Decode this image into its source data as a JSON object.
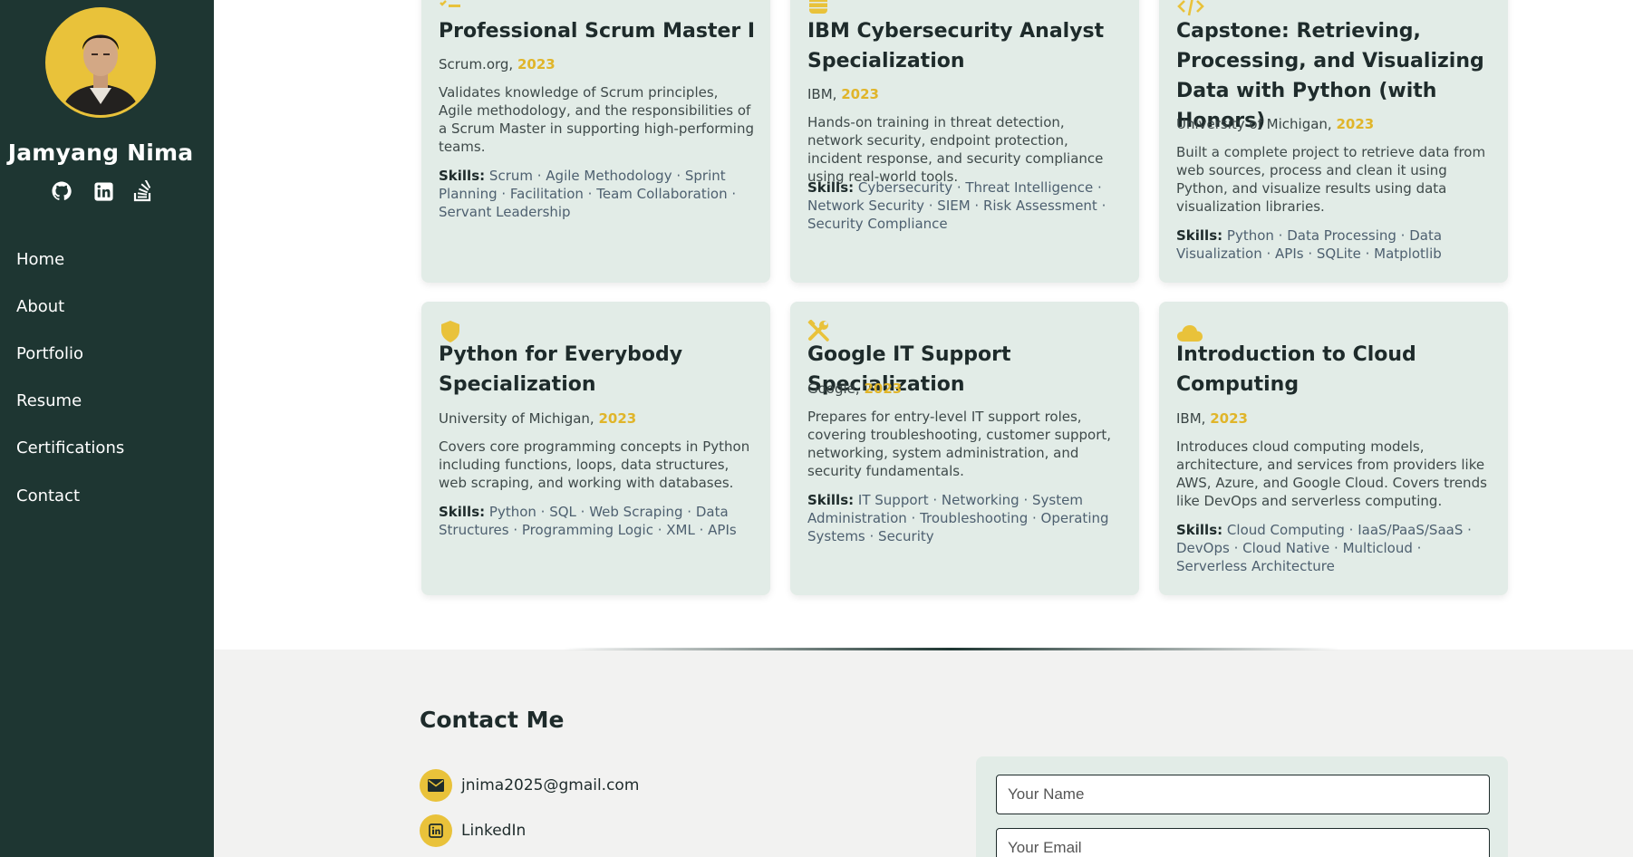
{
  "profile": {
    "name": "Jamyang Nima",
    "avatar_alt": "profile photo"
  },
  "socials": [
    {
      "icon": "github-icon"
    },
    {
      "icon": "linkedin-icon"
    },
    {
      "icon": "stackoverflow-icon"
    }
  ],
  "nav": {
    "items": [
      {
        "label": "Home"
      },
      {
        "label": "About"
      },
      {
        "label": "Portfolio"
      },
      {
        "label": "Resume"
      },
      {
        "label": "Certifications"
      },
      {
        "label": "Contact"
      }
    ]
  },
  "colors": {
    "sidebar": "#1e3632",
    "accent": "#e9c23a",
    "card_bg": "#e2ece7"
  },
  "skills_label": "Skills:",
  "certifications": [
    {
      "icon": "list-check-icon",
      "title": "Professional Scrum Master I",
      "issuer": "Scrum.org,",
      "year": "2023",
      "description": "Validates knowledge of Scrum principles, Agile methodology, and the responsibilities of a Scrum Master in supporting high-performing teams.",
      "skills": "Scrum · Agile Methodology · Sprint Planning · Facilitation · Team Collaboration · Servant Leadership"
    },
    {
      "icon": "database-icon",
      "title": "IBM Cybersecurity Analyst Specialization",
      "issuer": "IBM,",
      "year": "2023",
      "description": "Hands-on training in threat detection, network security, endpoint protection, incident response, and security compliance using real-world tools.",
      "skills": "Cybersecurity · Threat Intelligence · Network Security · SIEM · Risk Assessment · Security Compliance"
    },
    {
      "icon": "code-icon",
      "title": "Capstone: Retrieving, Processing, and Visualizing Data with Python (with Honors)",
      "issuer": "University of Michigan,",
      "year": "2023",
      "description": "Built a complete project to retrieve data from web sources, process and clean it using Python, and visualize results using data visualization libraries.",
      "skills": "Python · Data Processing · Data Visualization · APIs · SQLite · Matplotlib"
    },
    {
      "icon": "shield-icon",
      "title": "Python for Everybody Specialization",
      "issuer": "University of Michigan,",
      "year": "2023",
      "description": "Covers core programming concepts in Python including functions, loops, data structures, web scraping, and working with databases.",
      "skills": "Python · SQL · Web Scraping · Data Structures · Programming Logic · XML · APIs"
    },
    {
      "icon": "tools-icon",
      "title": "Google IT Support Specialization",
      "issuer": "Google,",
      "year": "2023",
      "description": "Prepares for entry-level IT support roles, covering troubleshooting, customer support, networking, system administration, and security fundamentals.",
      "skills": "IT Support · Networking · System Administration · Troubleshooting · Operating Systems · Security"
    },
    {
      "icon": "cloud-icon",
      "title": "Introduction to Cloud Computing",
      "issuer": "IBM,",
      "year": "2023",
      "description": "Introduces cloud computing models, architecture, and services from providers like AWS, Azure, and Google Cloud. Covers trends like DevOps and serverless computing.",
      "skills": "Cloud Computing · IaaS/PaaS/SaaS · DevOps · Cloud Native · Multicloud · Serverless Architecture"
    }
  ],
  "contact": {
    "title": "Contact Me",
    "email": "jnima2025@gmail.com",
    "linkedin": "LinkedIn",
    "form": {
      "name_placeholder": "Your Name",
      "email_placeholder": "Your Email"
    }
  }
}
